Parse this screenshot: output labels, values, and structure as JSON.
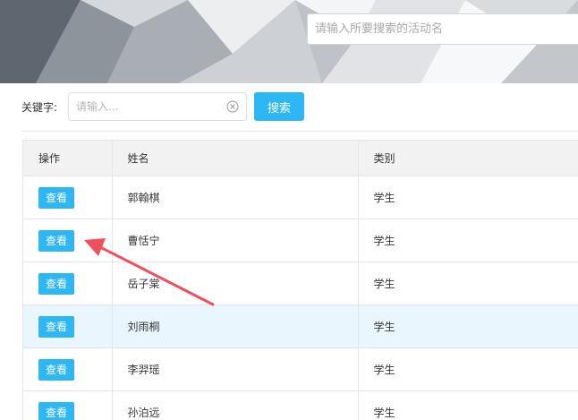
{
  "header": {
    "search_placeholder": "请输入所要搜索的活动名"
  },
  "filter": {
    "keyword_label": "关键字:",
    "keyword_placeholder": "请输入...",
    "search_button": "搜索"
  },
  "table": {
    "columns": [
      "操作",
      "姓名",
      "类别"
    ],
    "rows": [
      {
        "action": "查看",
        "name": "郭翰棋",
        "category": "学生"
      },
      {
        "action": "查看",
        "name": "曹恬宁",
        "category": "学生"
      },
      {
        "action": "查看",
        "name": "岳子棠",
        "category": "学生"
      },
      {
        "action": "查看",
        "name": "刘雨桐",
        "category": "学生"
      },
      {
        "action": "查看",
        "name": "李羿瑶",
        "category": "学生"
      },
      {
        "action": "查看",
        "name": "孙泊远",
        "category": "学生"
      }
    ],
    "highlighted_row": 3
  },
  "colors": {
    "accent": "#2db7f5",
    "row_highlight": "#eaf6fd",
    "annotation_arrow": "#f0505e"
  },
  "icons": {
    "clear": "circle-x-icon"
  }
}
